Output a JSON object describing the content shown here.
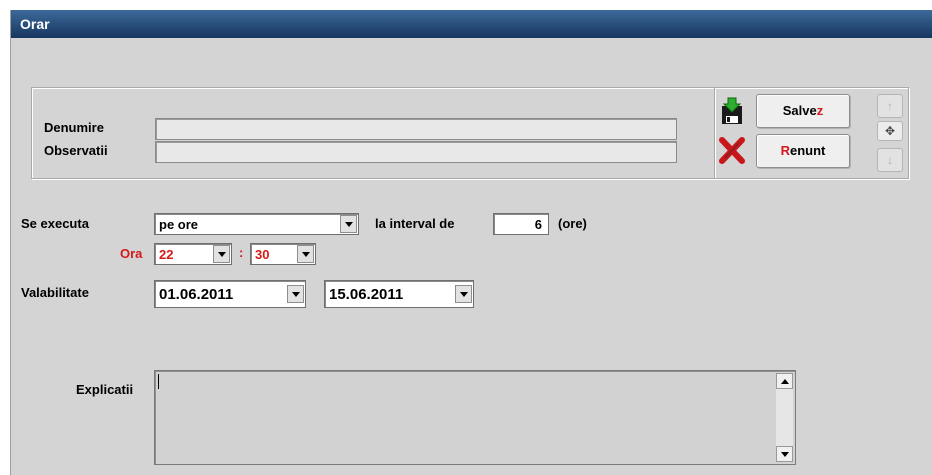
{
  "window": {
    "title": "Orar"
  },
  "form": {
    "denumire_label": "Denumire",
    "denumire_value": "",
    "observatii_label": "Observatii",
    "observatii_value": "",
    "se_executa_label": "Se executa",
    "se_executa_value": "pe ore",
    "interval_label": "la interval de",
    "interval_value": "6",
    "interval_unit": "(ore)",
    "ora_label": "Ora",
    "hour_value": "22",
    "time_separator": ":",
    "minute_value": "30",
    "valabilitate_label": "Valabilitate",
    "date_from": "01.06.2011",
    "date_to": "15.06.2011",
    "explicatii_label": "Explicatii",
    "explicatii_value": ""
  },
  "buttons": {
    "save_main": "Salve",
    "save_hotkey": "z",
    "cancel_hotkey": "R",
    "cancel_main": "enunt"
  },
  "icons": {
    "save": "save-disk-icon",
    "cancel": "red-x-icon",
    "up": "arrow-up-icon",
    "move": "move-icon",
    "down": "arrow-down-icon"
  },
  "colors": {
    "title_bar": "#1f4878",
    "label_red": "#d41a1a",
    "background": "#d4d4d4"
  }
}
